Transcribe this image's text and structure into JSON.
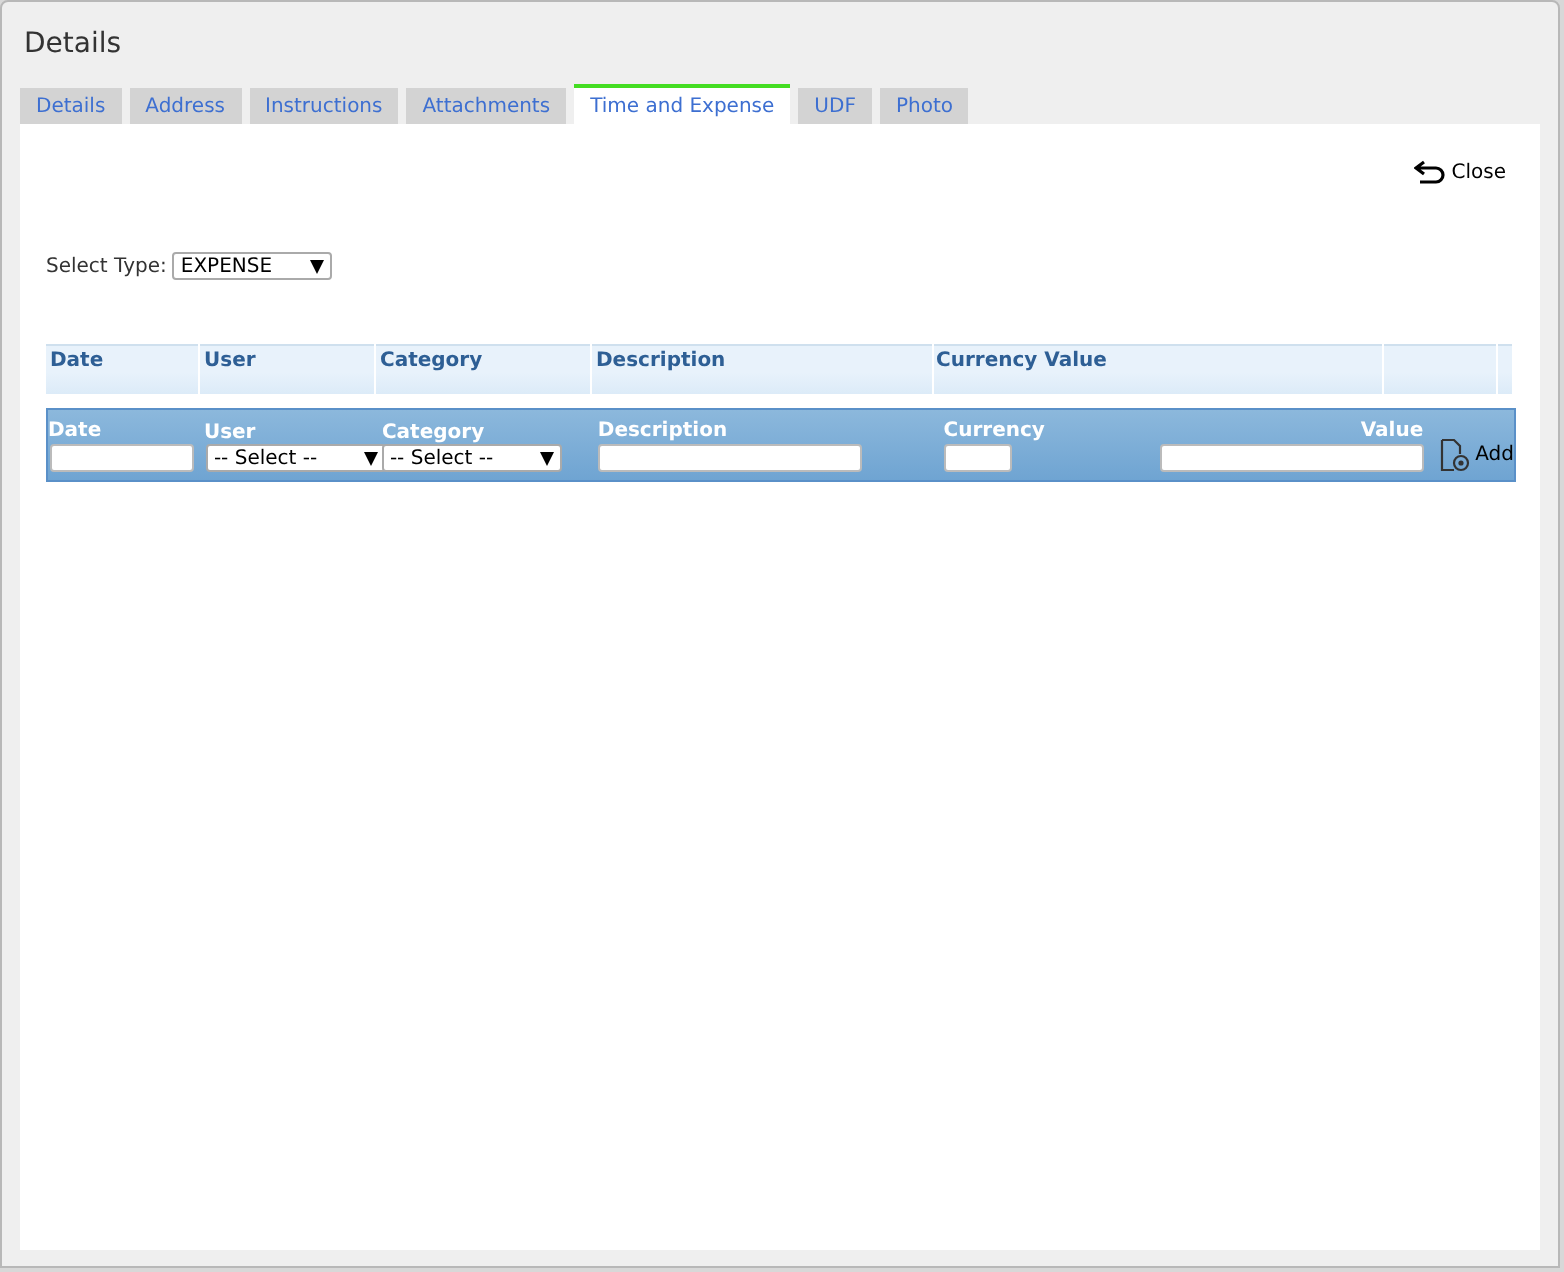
{
  "window": {
    "title": "Details"
  },
  "tabs": [
    {
      "label": "Details",
      "selected": false
    },
    {
      "label": "Address",
      "selected": false
    },
    {
      "label": "Instructions",
      "selected": false
    },
    {
      "label": "Attachments",
      "selected": false
    },
    {
      "label": "Time and Expense",
      "selected": true
    },
    {
      "label": "UDF",
      "selected": false
    },
    {
      "label": "Photo",
      "selected": false
    }
  ],
  "close_button": "Close",
  "select_type": {
    "label": "Select Type:",
    "value": "EXPENSE"
  },
  "table": {
    "columns": [
      "Date",
      "User",
      "Category",
      "Description",
      "Currency Value"
    ]
  },
  "add_row": {
    "date_label": "Date",
    "user_label": "User",
    "user_value": "-- Select --",
    "category_label": "Category",
    "category_value": "-- Select --",
    "description_label": "Description",
    "currency_label": "Currency",
    "value_label": "Value",
    "add_button": "Add"
  }
}
